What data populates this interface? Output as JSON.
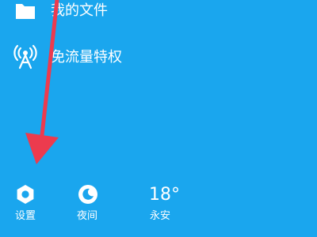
{
  "menu": {
    "items": [
      {
        "label": "我的文件",
        "icon": "folder-icon"
      },
      {
        "label": "免流量特权",
        "icon": "broadcast-tower-icon"
      }
    ]
  },
  "bottom_bar": {
    "settings": {
      "label": "设置",
      "icon": "settings-hexagon-icon"
    },
    "night_mode": {
      "label": "夜间",
      "icon": "moon-icon"
    },
    "weather": {
      "temperature": "18°",
      "location": "永安"
    }
  },
  "colors": {
    "background": "#1aa6ee",
    "foreground": "#ffffff",
    "annotation_arrow": "#ec3b4e"
  }
}
